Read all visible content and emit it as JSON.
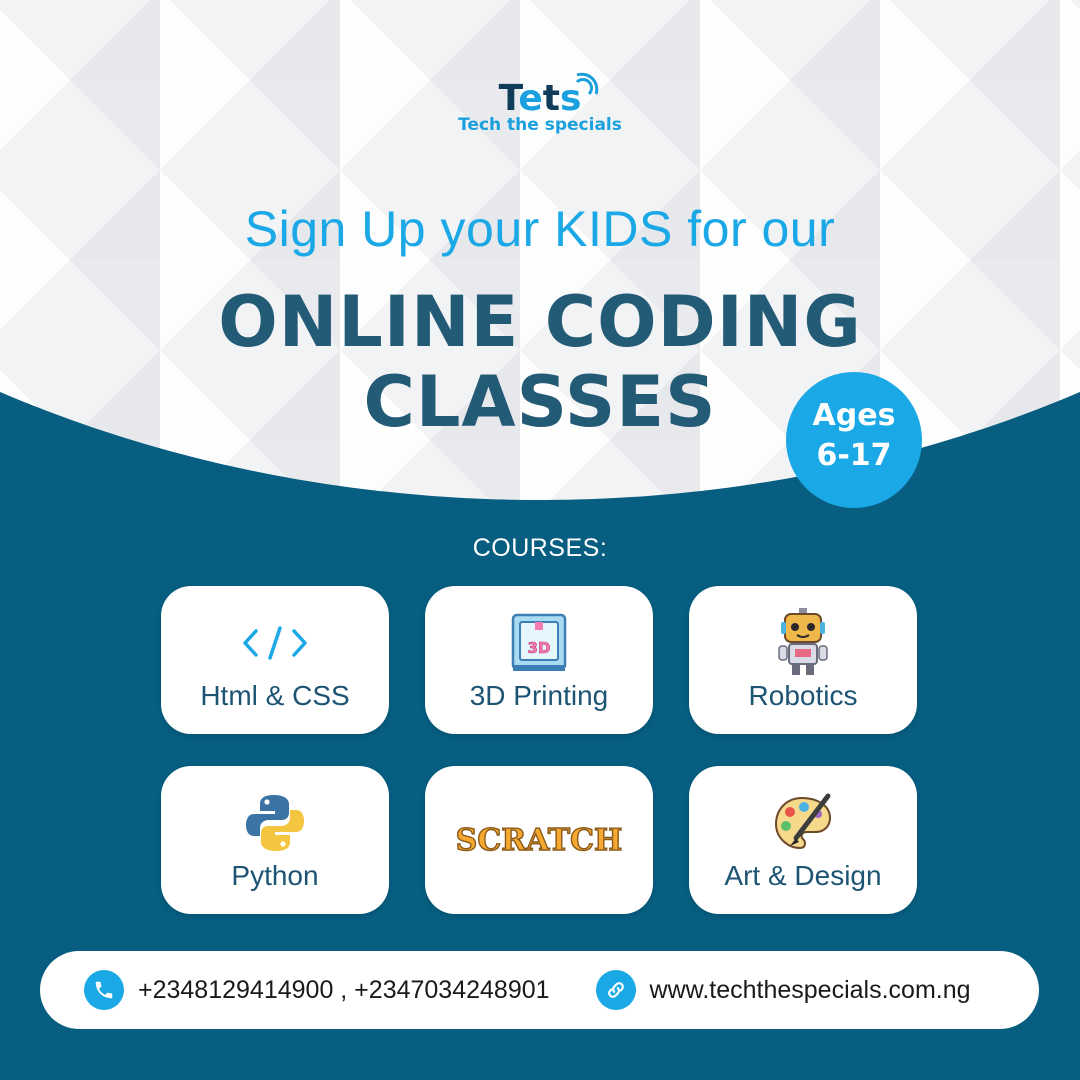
{
  "brand": {
    "logo_letters": [
      "T",
      "e",
      "t",
      "s"
    ],
    "tagline": "Tech the specials",
    "logo_colors": {
      "dark": "#0f3c58",
      "accent": "#1aa0de"
    }
  },
  "headline": {
    "line1": "Sign Up your KIDS for our",
    "line2": "ONLINE CODING",
    "line3": "CLASSES"
  },
  "ages_badge": {
    "line1": "Ages",
    "line2": "6-17"
  },
  "courses_label": "COURSES:",
  "courses": [
    {
      "label": "Html & CSS",
      "icon": "code-brackets-icon"
    },
    {
      "label": "3D Printing",
      "icon": "3d-printer-icon",
      "icon_text": "3D"
    },
    {
      "label": "Robotics",
      "icon": "robot-icon"
    },
    {
      "label": "Python",
      "icon": "python-logo-icon"
    },
    {
      "label": "",
      "icon": "scratch-logo-icon",
      "icon_text": "SCRATCH"
    },
    {
      "label": "Art & Design",
      "icon": "palette-brush-icon"
    }
  ],
  "contact": {
    "phone": "+2348129414900 , +2347034248901",
    "phone_icon": "phone-icon",
    "website": "www.techthespecials.com.ng",
    "website_icon": "link-icon"
  },
  "colors": {
    "background_blue": "#075e80",
    "accent_blue": "#1ba8e6",
    "heading_dark": "#235a76",
    "light_area": "#f2f3f5"
  }
}
